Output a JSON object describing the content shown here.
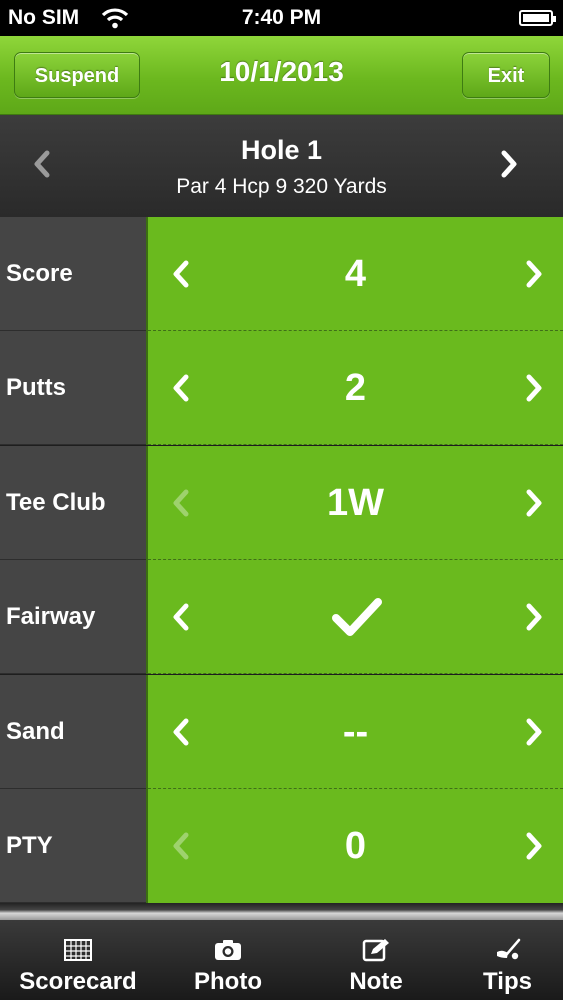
{
  "status_bar": {
    "carrier": "No SIM",
    "time": "7:40 PM"
  },
  "nav": {
    "suspend_label": "Suspend",
    "title": "10/1/2013",
    "exit_label": "Exit"
  },
  "hole": {
    "title": "Hole 1",
    "info": "Par 4  Hcp 9  320 Yards"
  },
  "rows": [
    {
      "label": "Score",
      "value": "4",
      "left_enabled": true,
      "right_enabled": true
    },
    {
      "label": "Putts",
      "value": "2",
      "left_enabled": true,
      "right_enabled": true
    },
    {
      "label": "Tee Club",
      "value": "1W",
      "left_enabled": false,
      "right_enabled": true
    },
    {
      "label": "Fairway",
      "value_icon": "checkmark-icon",
      "left_enabled": true,
      "right_enabled": true
    },
    {
      "label": "Sand",
      "value": "--",
      "left_enabled": true,
      "right_enabled": true
    },
    {
      "label": "PTY",
      "value": "0",
      "left_enabled": false,
      "right_enabled": true
    }
  ],
  "tabs": [
    {
      "label": "Scorecard",
      "icon": "scorecard-grid-icon"
    },
    {
      "label": "Photo",
      "icon": "camera-icon"
    },
    {
      "label": "Note",
      "icon": "pencil-note-icon"
    },
    {
      "label": "Tips",
      "icon": "golf-club-icon"
    }
  ],
  "colors": {
    "accent_green": "#6aba1e",
    "label_bg": "#454545",
    "header_bg": "#2f2f2f"
  }
}
